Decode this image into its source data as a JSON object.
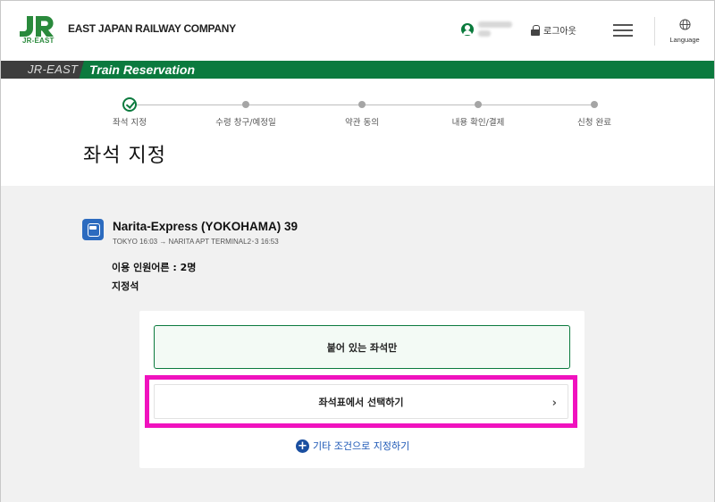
{
  "header": {
    "logo_sub": "JR-EAST",
    "company": "EAST JAPAN RAILWAY COMPANY",
    "logout_label": "로그아웃",
    "language_label": "Language"
  },
  "banner": {
    "brand": "JR-EAST",
    "title": "Train Reservation"
  },
  "steps": [
    {
      "label": "좌석 지정",
      "status": "done"
    },
    {
      "label": "수령 창구/예정일",
      "status": "pending"
    },
    {
      "label": "약관 동의",
      "status": "pending"
    },
    {
      "label": "내용 확인/결제",
      "status": "pending"
    },
    {
      "label": "신청 완료",
      "status": "pending"
    }
  ],
  "page_title": "좌석 지정",
  "train": {
    "name": "Narita-Express (YOKOHAMA) 39",
    "route": "TOKYO 16:03 → NARITA APT TERMINAL2･3 16:53",
    "passengers": "이용 인원어른 : 2명",
    "seat_type": "지정석"
  },
  "options": {
    "adjacent_label": "붙어 있는 좌석만",
    "seatmap_label": "좌석표에서 선택하기",
    "seatmap_chevron": "›",
    "other_label": "기타 조건으로 지정하기",
    "other_icon": "+"
  },
  "colors": {
    "brand_green": "#0b7a3e",
    "highlight_magenta": "#f012be",
    "link_blue": "#1a56b5",
    "train_icon_blue": "#2c6bbf"
  }
}
